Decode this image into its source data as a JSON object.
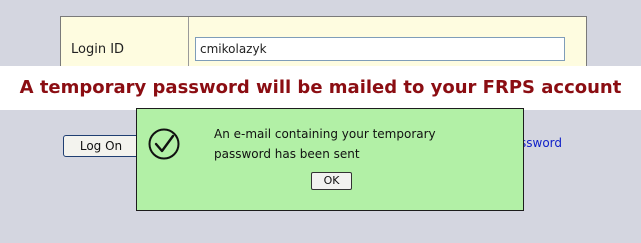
{
  "login": {
    "label": "Login ID",
    "value": "cmikolazyk"
  },
  "banner": {
    "text": "A temporary password will be mailed to your FRPS account"
  },
  "buttons": {
    "logon": "Log On"
  },
  "links": {
    "forgot_tail": "ssword"
  },
  "dialog": {
    "icon": "check-circle-icon",
    "message_line1": "An e-mail containing your temporary",
    "message_line2": "password has been sent",
    "ok": "OK"
  },
  "colors": {
    "page_bg": "#d4d6e0",
    "panel_bg": "#fefce0",
    "banner_text": "#8b0d12",
    "dialog_bg": "#b2f0a6",
    "link": "#1020c8"
  }
}
